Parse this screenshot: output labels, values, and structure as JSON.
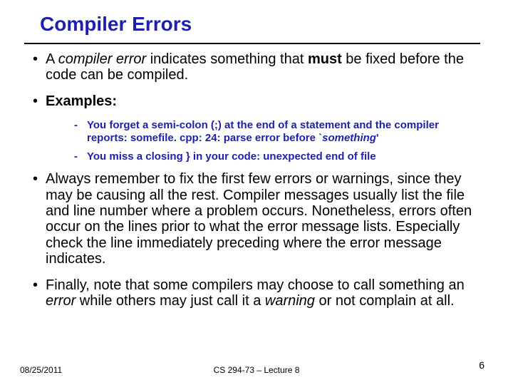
{
  "title": "Compiler Errors",
  "bullets": {
    "b1_pre": "A ",
    "b1_em": "compiler error",
    "b1_mid": " indicates something that ",
    "b1_bold": "must",
    "b1_post": " be fixed before the code can be compiled.",
    "b2": "Examples:",
    "b3": "Always remember to fix the first few errors or warnings, since they may be causing all the rest. Compiler messages usually list the file and line number where a problem occurs. Nonetheless, errors often occur on the lines prior to what the error message lists. Especially check the line immediately preceding where the error message indicates.",
    "b4_pre": "Finally, note that some compilers may choose to call something an ",
    "b4_em1": "error",
    "b4_mid": " while others may just call it a ",
    "b4_em2": "warning",
    "b4_post": " or not complain at all."
  },
  "sub": {
    "s1_pre": "You forget a semi-colon (;) at the end of a statement and the compiler reports:  somefile. cpp: 24: parse error before `",
    "s1_em": "something",
    "s1_post": "'",
    "s2": "You miss a closing } in your code: unexpected end of file"
  },
  "footer": {
    "date": "08/25/2011",
    "course": "CS 294-73 – Lecture 8",
    "page": "6"
  }
}
